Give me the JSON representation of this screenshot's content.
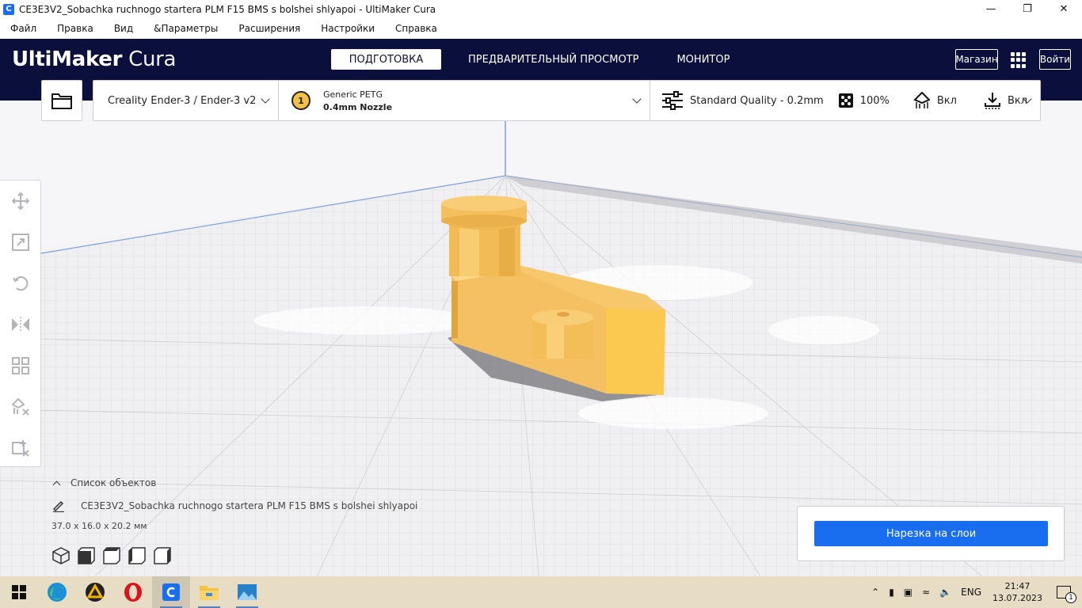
{
  "window": {
    "title": "CE3E3V2_Sobachka ruchnogo startera PLM F15 BMS s bolshei shlyapoi - UltiMaker Cura",
    "controls": [
      "minimize",
      "restore",
      "close"
    ]
  },
  "menu": [
    "Файл",
    "Правка",
    "Вид",
    "&Параметры",
    "Расширения",
    "Настройки",
    "Справка"
  ],
  "header": {
    "logo_bold": "UltiMaker",
    "logo_light": "Cura",
    "stages": [
      "ПОДГОТОВКА",
      "ПРЕДВАРИТЕЛЬНЫЙ ПРОСМОТР",
      "МОНИТОР"
    ],
    "active_stage": "ПОДГОТОВКА",
    "marketplace_label": "Магазин",
    "signin_label": "Войти"
  },
  "printer": {
    "name": "Creality Ender-3 / Ender-3 v2"
  },
  "material": {
    "extruder_number": "1",
    "name": "Generic PETG",
    "nozzle": "0.4mm Nozzle",
    "color": "#f2c046"
  },
  "print_settings": {
    "profile": "Standard Quality - 0.2mm",
    "infill": "100%",
    "support": "Вкл",
    "adhesion": "Вкл"
  },
  "toolbar": [
    "move-tool",
    "scale-tool",
    "rotate-tool",
    "mirror-tool",
    "per-model-settings-tool",
    "support-blocker-tool",
    "mesh-tools-tool"
  ],
  "object_list": {
    "header": "Список объектов",
    "object_name": "CE3E3V2_Sobachka ruchnogo startera PLM F15 BMS s bolshei shlyapoi",
    "dimensions": "37.0 x 16.0 x 20.2 мм"
  },
  "slice": {
    "button_label": "Нарезка на слои"
  },
  "taskbar": {
    "apps": [
      "windows-start",
      "edge",
      "aimp",
      "opera",
      "cura",
      "file-explorer",
      "photos"
    ],
    "language": "ENG",
    "time": "21:47",
    "date": "13.07.2023",
    "notification_count": "1"
  },
  "colors": {
    "header_bg": "#0b0f3b",
    "accent": "#196ef0",
    "model": "#f5c061",
    "taskbar": "#e7dcc4"
  }
}
